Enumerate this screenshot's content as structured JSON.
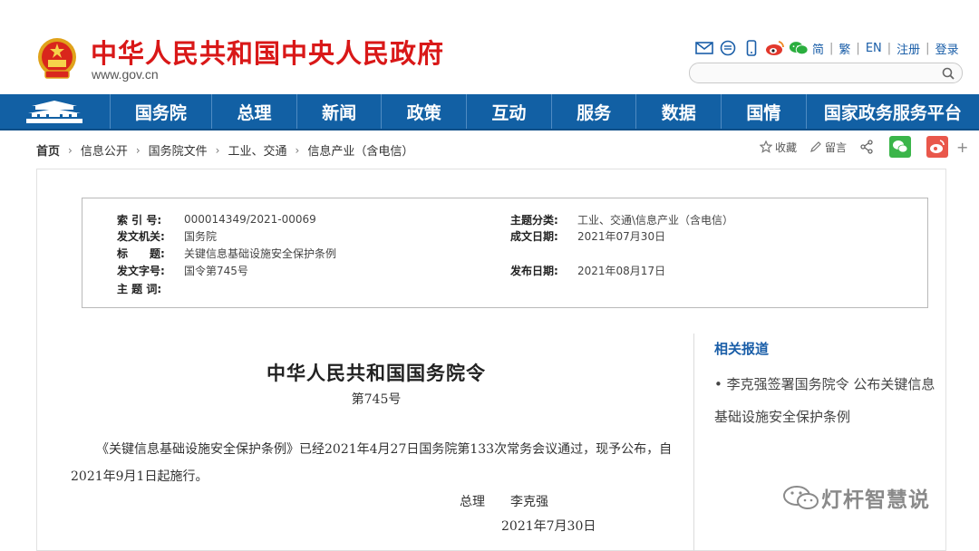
{
  "header": {
    "site_title": "中华人民共和国中央人民政府",
    "site_url": "www.gov.cn",
    "links": [
      "简",
      "繁",
      "EN",
      "注册",
      "登录"
    ],
    "search_placeholder": ""
  },
  "nav": {
    "items": [
      "国务院",
      "总理",
      "新闻",
      "政策",
      "互动",
      "服务",
      "数据",
      "国情",
      "国家政务服务平台"
    ]
  },
  "breadcrumb": [
    "首页",
    "信息公开",
    "国务院文件",
    "工业、交通",
    "信息产业（含电信）"
  ],
  "tools": {
    "favorite": "收藏",
    "comment": "留言"
  },
  "meta": {
    "index_label": "索 引 号:",
    "index_value": "000014349/2021-00069",
    "topic_label": "主题分类:",
    "topic_value": "工业、交通\\信息产业（含电信）",
    "issuer_label": "发文机关:",
    "issuer_value": "国务院",
    "created_label": "成文日期:",
    "created_value": "2021年07月30日",
    "title_label": "标　　题:",
    "title_value": "关键信息基础设施安全保护条例",
    "docno_label": "发文字号:",
    "docno_value": "国令第745号",
    "published_label": "发布日期:",
    "published_value": "2021年08月17日",
    "keywords_label": "主 题 词:",
    "keywords_value": ""
  },
  "related": {
    "title": "相关报道",
    "items": [
      "李克强签署国务院令 公布关键信息基础设施安全保护条例"
    ]
  },
  "document": {
    "title": "中华人民共和国国务院令",
    "number": "第745号",
    "body": "《关键信息基础设施安全保护条例》已经2021年4月27日国务院第133次常务会议通过，现予公布，自2021年9月1日起施行。",
    "signer_title": "总理",
    "signer_name": "李克强",
    "date": "2021年7月30日"
  },
  "watermark": "灯杆智慧说",
  "colors": {
    "brand_red": "#d91818",
    "nav_blue": "#1260a4",
    "link_blue": "#1a5ea8"
  }
}
